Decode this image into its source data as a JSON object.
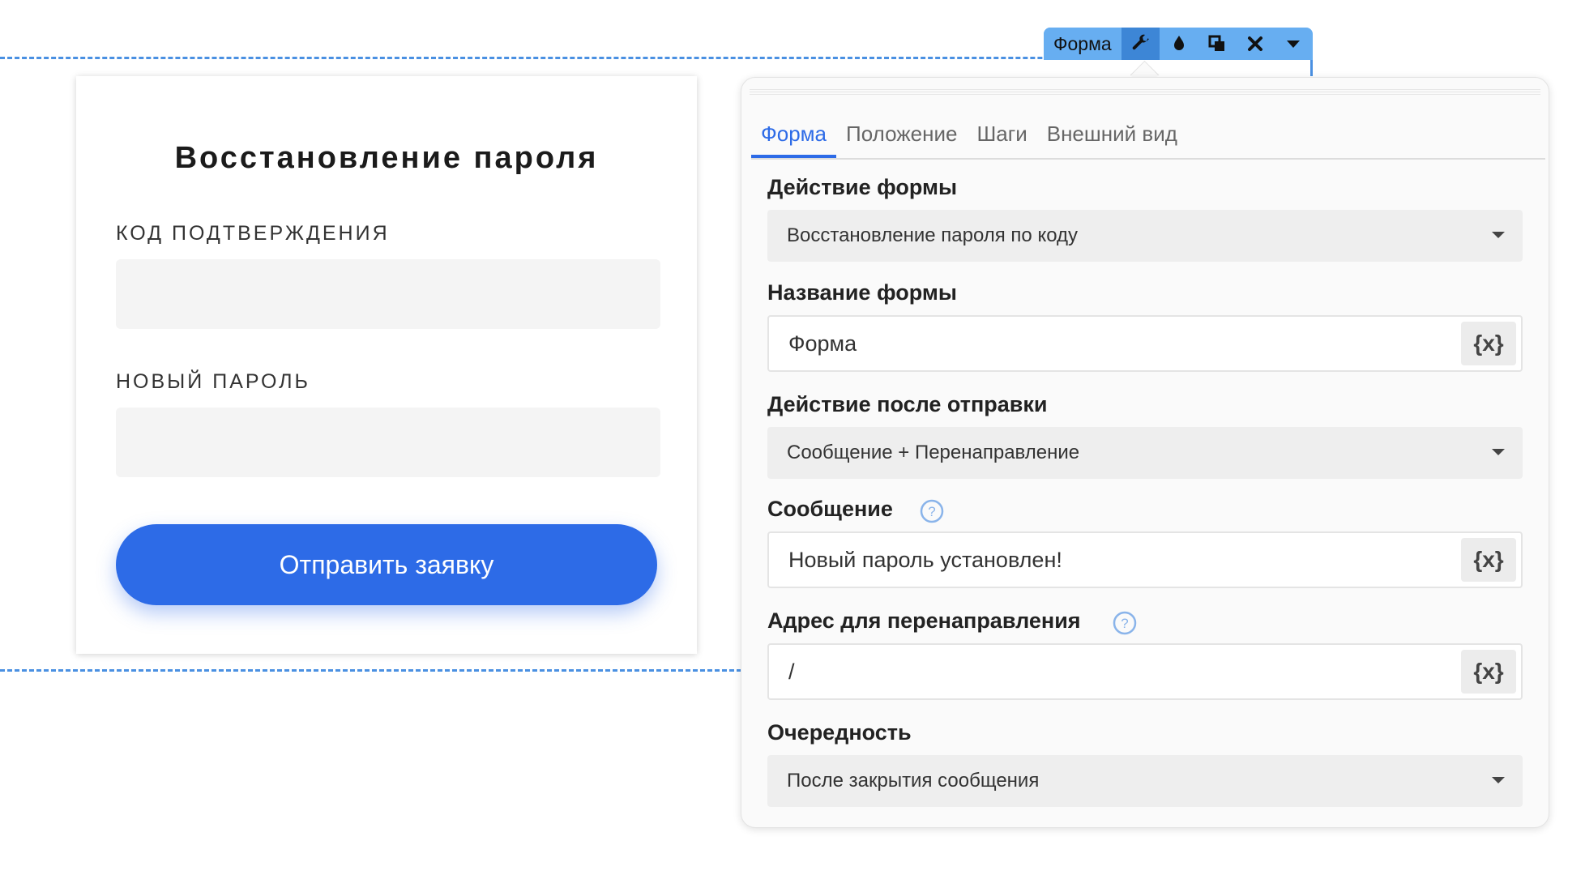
{
  "toolbar": {
    "label": "Форма",
    "icons": [
      "wrench-icon",
      "droplet-icon",
      "copy-icon",
      "close-icon",
      "chevron-down-icon"
    ]
  },
  "form": {
    "title": "Восстановление пароля",
    "fields": [
      {
        "label": "КОД ПОДТВЕРЖДЕНИЯ",
        "value": ""
      },
      {
        "label": "НОВЫЙ ПАРОЛЬ",
        "value": ""
      }
    ],
    "submit_label": "Отправить заявку"
  },
  "panel": {
    "tabs": [
      "Форма",
      "Положение",
      "Шаги",
      "Внешний вид"
    ],
    "active_tab": "Форма",
    "action": {
      "label": "Действие формы",
      "value": "Восстановление пароля по коду"
    },
    "name": {
      "label": "Название формы",
      "value": "Форма",
      "var_label": "{x}"
    },
    "after_submit": {
      "label": "Действие после отправки",
      "value": "Сообщение + Перенаправление"
    },
    "message": {
      "label": "Сообщение",
      "value": "Новый пароль установлен!",
      "var_label": "{x}"
    },
    "redirect": {
      "label": "Адрес для перенаправления",
      "value": "/",
      "var_label": "{x}"
    },
    "order": {
      "label": "Очередность",
      "value": "После закрытия сообщения"
    }
  },
  "colors": {
    "accent": "#2d6be7",
    "toolbar": "#67aef1",
    "selection": "#4a90e2"
  }
}
